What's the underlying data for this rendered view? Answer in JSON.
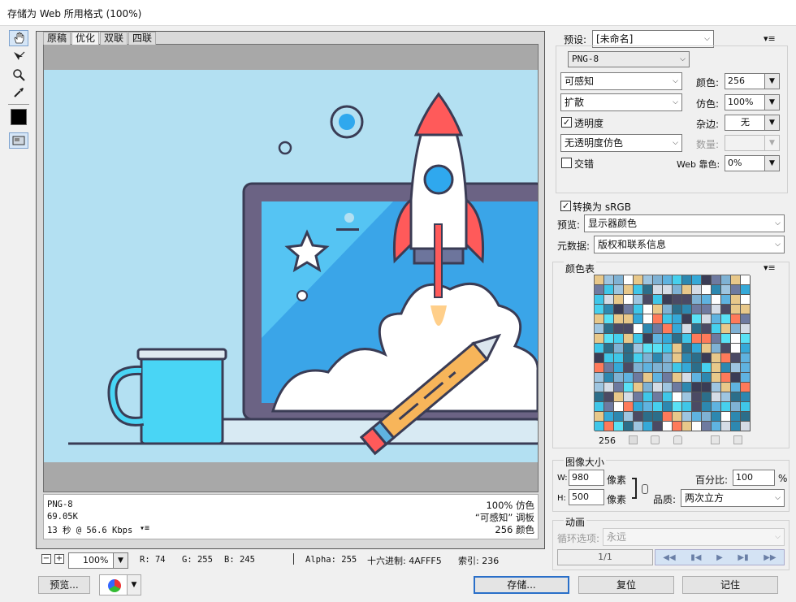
{
  "window": {
    "title": "存储为 Web 所用格式 (100%)"
  },
  "tabs": [
    "原稿",
    "优化",
    "双联",
    "四联"
  ],
  "info": {
    "format": "PNG-8",
    "size": "69.05K",
    "time": "13 秒 @ 56.6 Kbps",
    "dither": "100% 仿色",
    "palette": "“可感知” 调板",
    "colors": "256 颜色"
  },
  "status": {
    "zoom": "100%",
    "r": "R: 74",
    "g": "G: 255",
    "b": "B: 245",
    "alpha": "Alpha: 255",
    "hex": "十六进制: 4AFFF5",
    "index": "索引: 236"
  },
  "bottom": {
    "preview": "预览...",
    "save": "存储...",
    "reset": "复位",
    "remember": "记住"
  },
  "settings": {
    "preset_label": "预设:",
    "preset_value": "[未命名]",
    "format": "PNG-8",
    "reduction": "可感知",
    "dither_algo": "扩散",
    "colors_label": "颜色:",
    "colors_value": "256",
    "dither_label": "仿色:",
    "dither_value": "100%",
    "transparency_label": "透明度",
    "matte_label": "杂边:",
    "matte_value": "无",
    "transp_dither": "无透明度仿色",
    "amount_label": "数量:",
    "interlaced_label": "交错",
    "websnap_label": "Web 靠色:",
    "websnap_value": "0%",
    "srgb_label": "转换为 sRGB",
    "preview_label": "预览:",
    "preview_value": "显示器颜色",
    "metadata_label": "元数据:",
    "metadata_value": "版权和联系信息"
  },
  "color_table": {
    "label": "颜色表",
    "count": "256",
    "colors": [
      "#2c6e8a",
      "#7fb2d4",
      "#3fc6e8",
      "#ffffff",
      "#35a9d8",
      "#4b4a64",
      "#2d88b0",
      "#e8c88a",
      "#9ec5e0",
      "#46d0ee",
      "#6e7aa0",
      "#ff7a5a",
      "#3a3c55",
      "#59e1f5",
      "#5fb3e0",
      "#d5dce6"
    ]
  },
  "image_size": {
    "label": "图像大小",
    "w_label": "W:",
    "w_value": "980",
    "h_label": "H:",
    "h_value": "500",
    "unit": "像素",
    "percent_label": "百分比:",
    "percent_value": "100",
    "percent_unit": "%",
    "quality_label": "品质:",
    "quality_value": "两次立方"
  },
  "animation": {
    "label": "动画",
    "loop_label": "循环选项:",
    "loop_value": "永远",
    "frame": "1/1"
  }
}
